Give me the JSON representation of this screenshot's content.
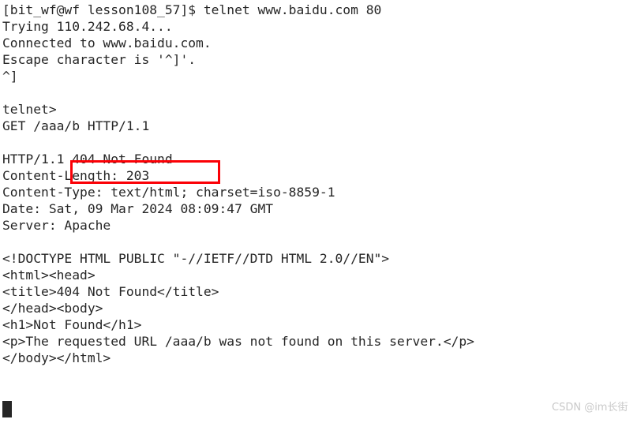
{
  "terminal": {
    "background_color": "#ffffff",
    "text_color": "#262626",
    "lines": [
      "[bit_wf@wf lesson108_57]$ telnet www.baidu.com 80",
      "Trying 110.242.68.4...",
      "Connected to www.baidu.com.",
      "Escape character is '^]'.",
      "^]",
      "",
      "telnet>",
      "GET /aaa/b HTTP/1.1",
      "",
      "HTTP/1.1 404 Not Found",
      "Content-Length: 203",
      "Content-Type: text/html; charset=iso-8859-1",
      "Date: Sat, 09 Mar 2024 08:09:47 GMT",
      "Server: Apache",
      "",
      "<!DOCTYPE HTML PUBLIC \"-//IETF//DTD HTML 2.0//EN\">",
      "<html><head>",
      "<title>404 Not Found</title>",
      "</head><body>",
      "<h1>Not Found</h1>",
      "<p>The requested URL /aaa/b was not found on this server.</p>",
      "</body></html>"
    ]
  },
  "annotation": {
    "highlight_text": "404 Not Found",
    "highlight_color": "#fb0006"
  },
  "cursor": {
    "visible": true
  },
  "watermark": {
    "text": "CSDN @im长街",
    "color": "#c9c9c9"
  }
}
